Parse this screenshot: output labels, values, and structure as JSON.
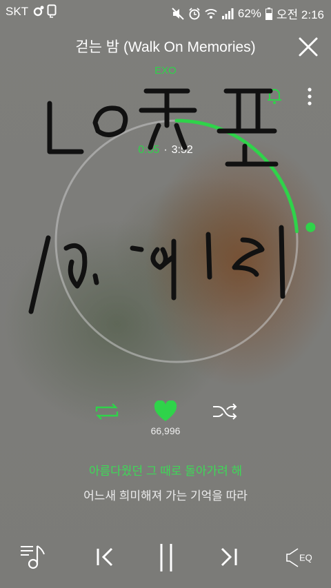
{
  "status_bar": {
    "carrier": "SKT",
    "battery": "62%",
    "time": "오전 2:16"
  },
  "player": {
    "song_title": "걷는 밤 (Walk On Memories)",
    "artist": "EXO",
    "current_time": "0:55",
    "duration": "3:52",
    "progress": 0.237,
    "likes": "66,996",
    "liked": true,
    "lyric_current": "아름다웠던 그 때로 돌아가려 해",
    "lyric_next": "어느새 희미해져 가는 기억을 따라"
  },
  "controls": {
    "eq_label": "EQ"
  },
  "colors": {
    "accent": "#2fd34a",
    "text": "#ffffff"
  },
  "icons": [
    "close-icon",
    "bell-icon",
    "more-vertical-icon",
    "repeat-icon",
    "heart-icon",
    "shuffle-icon",
    "playlist-icon",
    "previous-icon",
    "pause-icon",
    "next-icon",
    "eq-icon"
  ]
}
